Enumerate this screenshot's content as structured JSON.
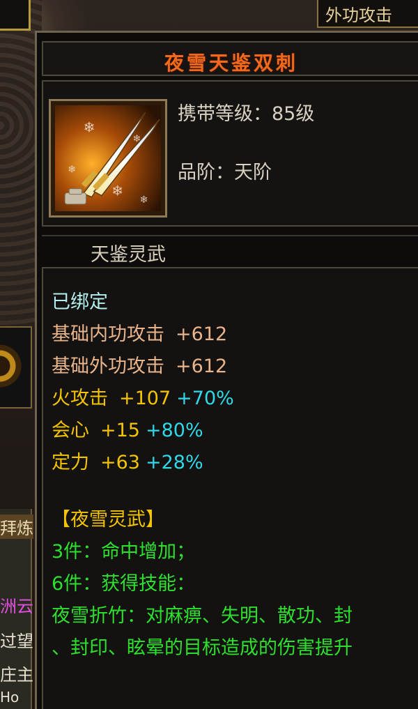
{
  "background": {
    "top_right_tab_label": "外功攻击",
    "side_texts": [
      "拜炼",
      "洲云",
      "过望",
      "庄主",
      "Ho"
    ]
  },
  "tooltip": {
    "item_name": "夜雪天鉴双刺",
    "item_icon": "twin-daggers-icon",
    "carry_level_label": "携带等级：85级",
    "grade_label": "品阶：天阶",
    "set_category": "天鉴灵武",
    "bind_status": "已绑定",
    "base_stats": [
      {
        "name": "基础内功攻击",
        "value": "+612"
      },
      {
        "name": "基础外功攻击",
        "value": "+612"
      }
    ],
    "extra_stats": [
      {
        "name": "火攻击",
        "value": "+107",
        "bonus": "+70%"
      },
      {
        "name": "会心",
        "value": "+15",
        "bonus": "+80%"
      },
      {
        "name": "定力",
        "value": "+63",
        "bonus": "+28%"
      }
    ],
    "set": {
      "title": "【夜雪灵武】",
      "lines": [
        "3件：命中增加；",
        "6件：获得技能：",
        "夜雪折竹：对麻痹、失明、散功、封",
        "、封印、眩晕的目标造成的伤害提升"
      ]
    }
  },
  "colors": {
    "item_name": "#f06a1e",
    "bind": "#b3f0f0",
    "base_stat": "#eab48a",
    "extra_stat": "#f4c400",
    "bonus": "#30d8e8",
    "set_text": "#2ee02e",
    "border": "#6e6450"
  }
}
